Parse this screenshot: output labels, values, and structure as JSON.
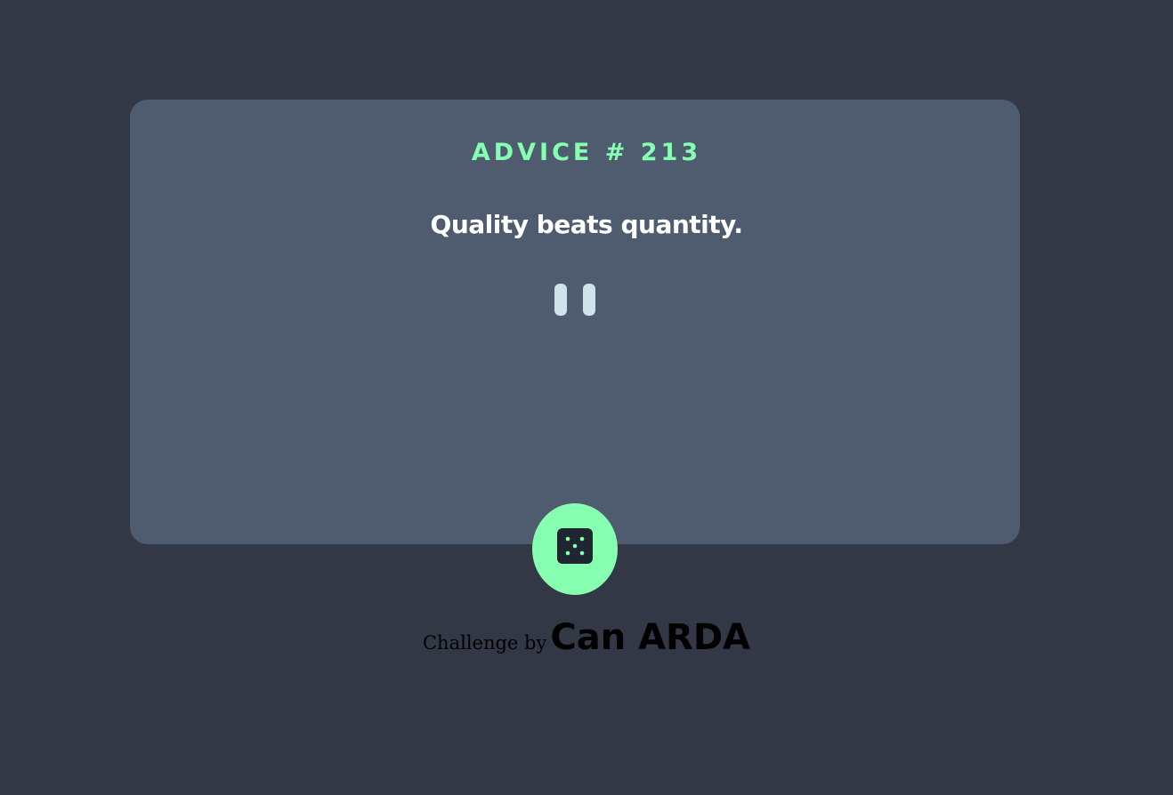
{
  "advice": {
    "label": "ADVICE # 213",
    "text": "Quality beats quantity."
  },
  "controls": {
    "divider_icon": "pause-icon",
    "roll_icon": "dice-icon"
  },
  "footer": {
    "lead": "Challenge by",
    "author": "Can ARDA"
  },
  "colors": {
    "background": "#323846",
    "card": "#4f5c70",
    "accent": "#86ffb1",
    "text": "#ffffff",
    "divider": "#cfe3eb",
    "dice_face": "#1f2632"
  }
}
